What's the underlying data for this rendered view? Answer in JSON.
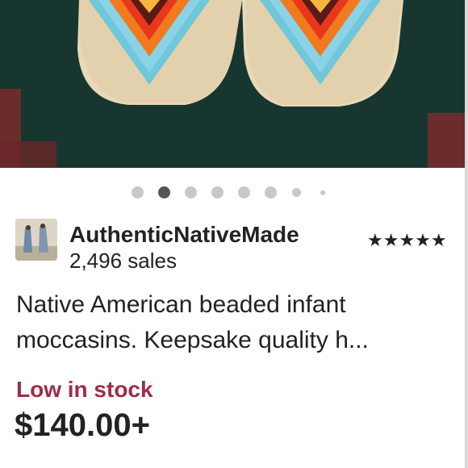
{
  "carousel": {
    "image_alt": "Beaded infant moccasins on woven rug",
    "dot_count": 8,
    "active_index": 1
  },
  "shop": {
    "name": "AuthenticNativeMade",
    "sales": "2,496 sales",
    "rating_stars": "★★★★★",
    "rating": 5
  },
  "listing": {
    "title": "Native American beaded infant moccasins. Keepsake quality h...",
    "stock_status": "Low in stock",
    "price": "$140.00+"
  },
  "colors": {
    "stock": "#9c2e47",
    "text": "#222222",
    "dot_inactive": "#c8c8c8",
    "dot_active": "#555555"
  }
}
